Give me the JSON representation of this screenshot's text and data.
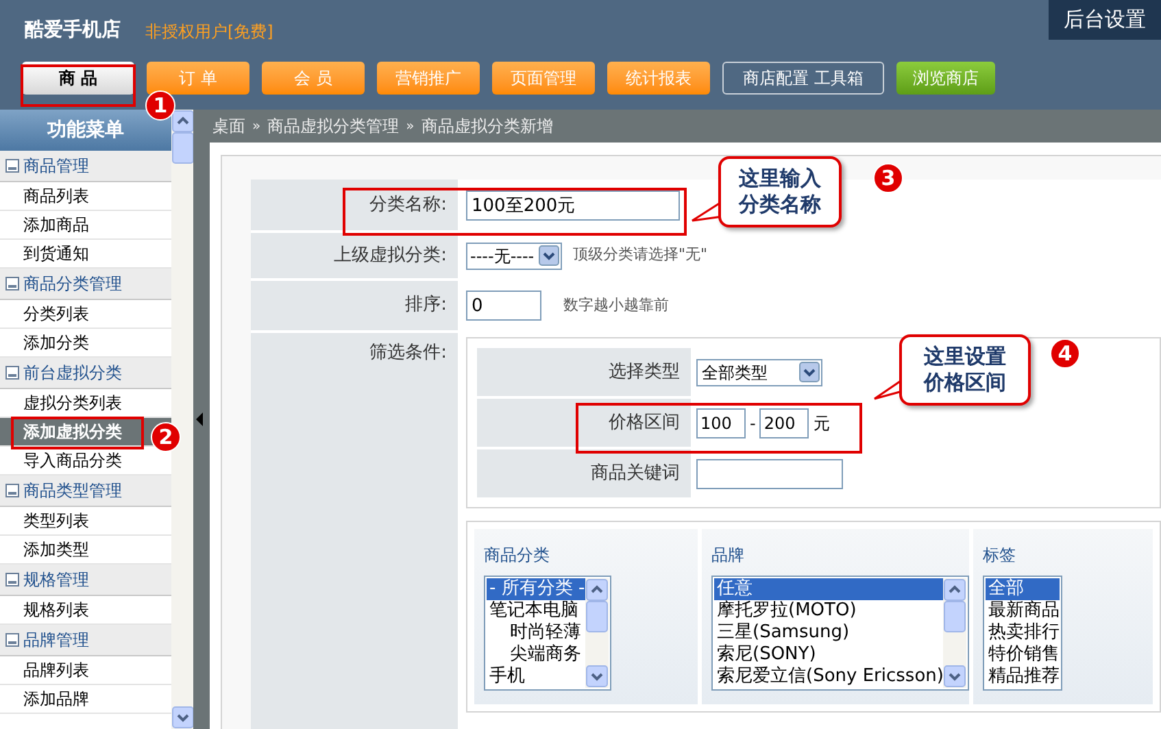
{
  "header": {
    "shop_name": "酷爱手机店",
    "user_status": "非授权用户[免费]",
    "admin_title": "后台设置"
  },
  "nav": [
    {
      "label": "商 品",
      "kind": "tab",
      "selected": true
    },
    {
      "label": "订 单",
      "kind": "tab",
      "selected": false
    },
    {
      "label": "会 员",
      "kind": "tab",
      "selected": false
    },
    {
      "label": "营销推广",
      "kind": "tab",
      "selected": false
    },
    {
      "label": "页面管理",
      "kind": "tab",
      "selected": false
    },
    {
      "label": "统计报表",
      "kind": "tab",
      "selected": false
    },
    {
      "label": "商店配置 工具箱",
      "kind": "outline",
      "selected": false
    },
    {
      "label": "浏览商店",
      "kind": "green",
      "selected": false
    }
  ],
  "sidebar": {
    "title": "功能菜单",
    "groups": [
      {
        "label": "商品管理",
        "items": [
          {
            "label": "商品列表",
            "selected": false
          },
          {
            "label": "添加商品",
            "selected": false
          },
          {
            "label": "到货通知",
            "selected": false
          }
        ]
      },
      {
        "label": "商品分类管理",
        "items": [
          {
            "label": "分类列表",
            "selected": false
          },
          {
            "label": "添加分类",
            "selected": false
          }
        ]
      },
      {
        "label": "前台虚拟分类",
        "items": [
          {
            "label": "虚拟分类列表",
            "selected": false
          },
          {
            "label": "添加虚拟分类",
            "selected": true
          },
          {
            "label": "导入商品分类",
            "selected": false
          }
        ]
      },
      {
        "label": "商品类型管理",
        "items": [
          {
            "label": "类型列表",
            "selected": false
          },
          {
            "label": "添加类型",
            "selected": false
          }
        ]
      },
      {
        "label": "规格管理",
        "items": [
          {
            "label": "规格列表",
            "selected": false
          }
        ]
      },
      {
        "label": "品牌管理",
        "items": [
          {
            "label": "品牌列表",
            "selected": false
          },
          {
            "label": "添加品牌",
            "selected": false
          }
        ]
      }
    ]
  },
  "breadcrumb": {
    "separator": "»",
    "items": [
      "桌面",
      "商品虚拟分类管理",
      "商品虚拟分类新增"
    ]
  },
  "form": {
    "name_label": "分类名称:",
    "name_value": "100至200元",
    "parent_label": "上级虚拟分类:",
    "parent_value": "----无----",
    "parent_hint": "顶级分类请选择\"无\"",
    "order_label": "排序:",
    "order_value": "0",
    "order_hint": "数字越小越靠前",
    "filter_label": "筛选条件:"
  },
  "filter": {
    "type_label": "选择类型",
    "type_value": "全部类型",
    "price_label": "价格区间",
    "price_min": "100",
    "price_sep": "-",
    "price_max": "200",
    "price_unit": "元",
    "keyword_label": "商品关键词"
  },
  "lists": [
    {
      "title": "商品分类",
      "options": [
        {
          "label": "- 所有分类 -",
          "selected": true
        },
        {
          "label": "笔记本电脑",
          "selected": false,
          "children": [
            {
              "label": "时尚轻薄",
              "selected": false
            },
            {
              "label": "尖端商务",
              "selected": false
            }
          ]
        },
        {
          "label": "手机",
          "selected": false
        }
      ]
    },
    {
      "title": "品牌",
      "options": [
        {
          "label": "任意",
          "selected": true
        },
        {
          "label": "摩托罗拉(MOTO)",
          "selected": false
        },
        {
          "label": "三星(Samsung)",
          "selected": false
        },
        {
          "label": "索尼(SONY)",
          "selected": false
        },
        {
          "label": "索尼爱立信(Sony Ericsson)",
          "selected": false
        }
      ]
    },
    {
      "title": "标签",
      "options": [
        {
          "label": "全部",
          "selected": true
        },
        {
          "label": "最新商品",
          "selected": false
        },
        {
          "label": "热卖排行",
          "selected": false
        },
        {
          "label": "特价销售",
          "selected": false
        },
        {
          "label": "精品推荐",
          "selected": false
        }
      ]
    }
  ],
  "annotations": [
    {
      "number": "1"
    },
    {
      "number": "2"
    },
    {
      "number": "3",
      "text": "这里输入分类名称"
    },
    {
      "number": "4",
      "text": "这里设置价格区间"
    }
  ]
}
